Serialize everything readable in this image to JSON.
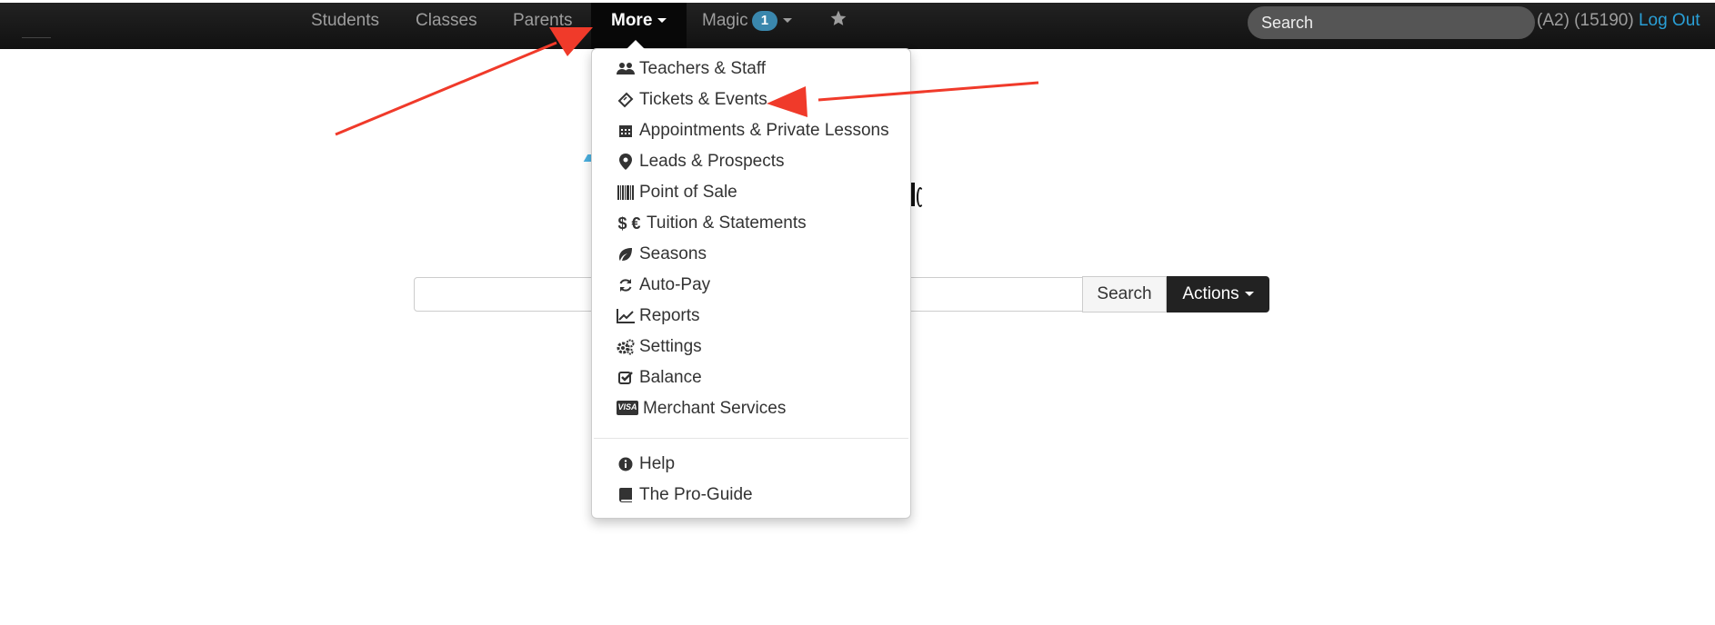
{
  "navbar": {
    "items": [
      {
        "label": "Students"
      },
      {
        "label": "Classes"
      },
      {
        "label": "Parents"
      }
    ],
    "more_label": "More",
    "magic_label": "Magic",
    "magic_badge": "1",
    "search_placeholder": "Search",
    "user_text": "(A2) (15190) ",
    "logout_label": "Log Out"
  },
  "main": {
    "search_button": "Search",
    "actions_button": "Actions"
  },
  "dropdown": {
    "items": [
      {
        "icon": "users-icon",
        "label": "Teachers & Staff"
      },
      {
        "icon": "ticket-icon",
        "label": "Tickets & Events"
      },
      {
        "icon": "calendar-icon",
        "label": "Appointments & Private Lessons"
      },
      {
        "icon": "map-marker-icon",
        "label": "Leads & Prospects"
      },
      {
        "icon": "barcode-icon",
        "label": "Point of Sale"
      },
      {
        "icon": "currency-icon",
        "icon_text": "$ €",
        "label": "Tuition & Statements"
      },
      {
        "icon": "leaf-icon",
        "label": "Seasons"
      },
      {
        "icon": "refresh-icon",
        "label": "Auto-Pay"
      },
      {
        "icon": "line-chart-icon",
        "label": "Reports"
      },
      {
        "icon": "cogs-icon",
        "label": "Settings"
      },
      {
        "icon": "check-square-icon",
        "label": "Balance"
      },
      {
        "icon": "visa-card-icon",
        "icon_text": "VISA",
        "label": "Merchant Services"
      }
    ],
    "secondary_items": [
      {
        "icon": "info-circle-icon",
        "label": "Help"
      },
      {
        "icon": "book-icon",
        "label": "The Pro-Guide"
      }
    ]
  },
  "colors": {
    "navbar_bg": "#111111",
    "link_blue": "#2a9fd6",
    "badge_blue": "#3a87ad",
    "annotation_arrow": "#f03a2a"
  }
}
